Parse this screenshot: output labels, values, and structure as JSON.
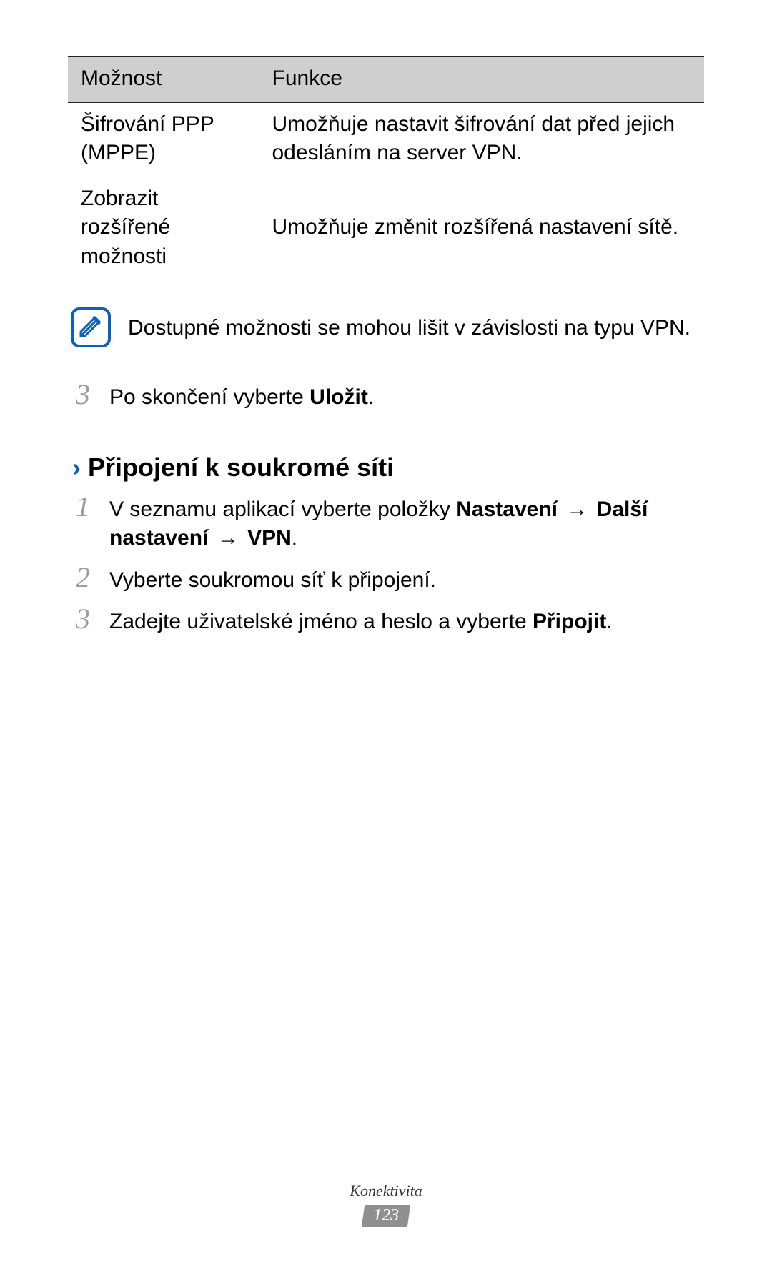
{
  "table": {
    "header_option": "Možnost",
    "header_function": "Funkce",
    "rows": [
      {
        "option": "Šifrování PPP (MPPE)",
        "function": "Umožňuje nastavit šifrování dat před jejich odesláním na server VPN."
      },
      {
        "option": "Zobrazit rozšířené možnosti",
        "function": "Umožňuje změnit rozšířená nastavení sítě."
      }
    ]
  },
  "note": "Dostupné možnosti se mohou lišit v závislosti na typu VPN.",
  "pre_step": {
    "num": "3",
    "text_a": "Po skončení vyberte ",
    "bold": "Uložit",
    "text_b": "."
  },
  "section_title": "Připojení k soukromé síti",
  "steps": [
    {
      "num": "1",
      "parts": [
        "V seznamu aplikací vyberte položky ",
        "Nastavení",
        " → ",
        "Další nastavení",
        " → ",
        "VPN",
        "."
      ]
    },
    {
      "num": "2",
      "plain": "Vyberte soukromou síť k připojení."
    },
    {
      "num": "3",
      "parts": [
        "Zadejte uživatelské jméno a heslo a vyberte ",
        "Připojit",
        "."
      ]
    }
  ],
  "footer_chapter": "Konektivita",
  "page_number": "123"
}
